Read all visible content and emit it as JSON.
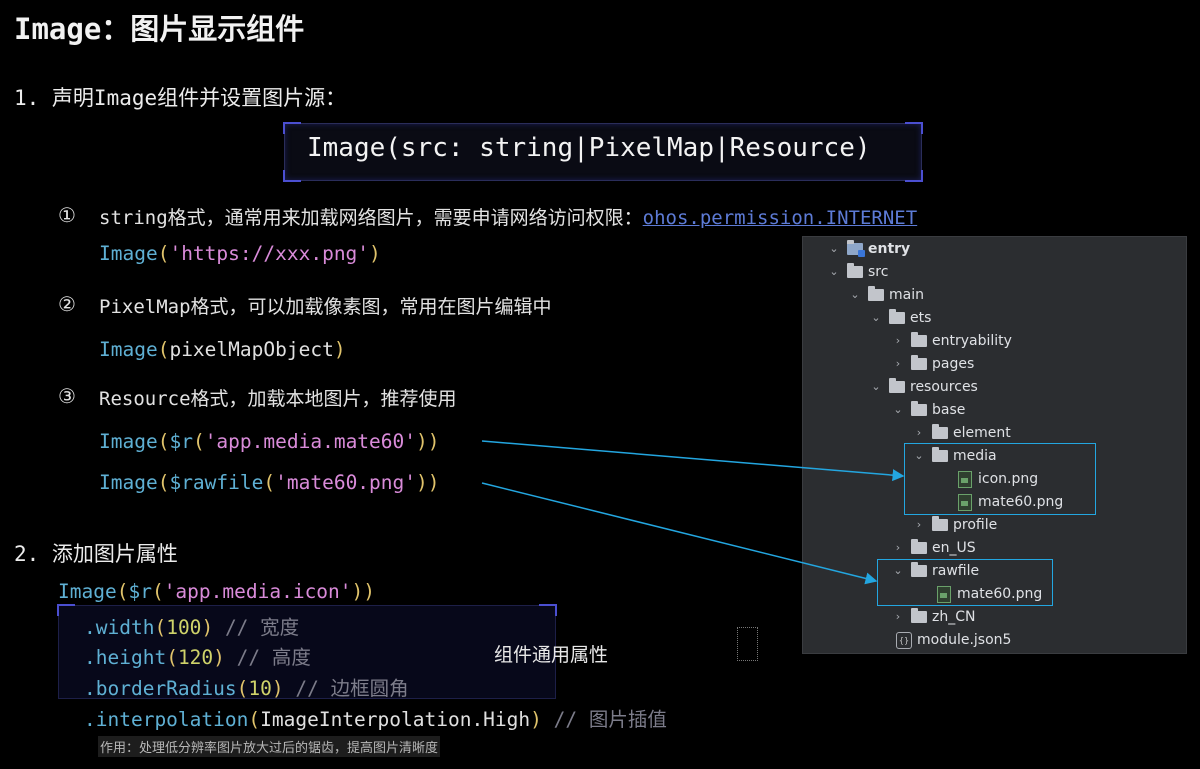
{
  "title": "Image：图片显示组件",
  "step1": {
    "heading": "1. 声明Image组件并设置图片源：",
    "signature": "Image(src: string|PixelMap|Resource)",
    "items": [
      {
        "marker": "①",
        "desc_prefix": "string格式，通常用来加载网络图片，需要申请网络访问权限：",
        "desc_link": "ohos.permission.INTERNET",
        "code": [
          {
            "fn": "Image",
            "open": "(",
            "arg": "'https://xxx.png'",
            "close": ")"
          }
        ]
      },
      {
        "marker": "②",
        "desc_prefix": "PixelMap格式，可以加载像素图，常用在图片编辑中",
        "code": [
          {
            "fn": "Image",
            "open": "(",
            "arg": "pixelMapObject",
            "close": ")"
          }
        ]
      },
      {
        "marker": "③",
        "desc_prefix": "Resource格式，加载本地图片，推荐使用",
        "code": [
          {
            "fn": "Image",
            "open": "(",
            "fn2": "$r",
            "open2": "(",
            "arg": "'app.media.mate60'",
            "close": "))"
          },
          {
            "fn": "Image",
            "open": "(",
            "fn2": "$rawfile",
            "open2": "(",
            "arg": "'mate60.png'",
            "close": "))"
          }
        ]
      }
    ]
  },
  "step2": {
    "heading": "2. 添加图片属性",
    "first_line": {
      "fn": "Image",
      "open": "(",
      "fn2": "$r",
      "open2": "(",
      "arg": "'app.media.icon'",
      "close": "))"
    },
    "props": [
      {
        "name": ".width",
        "open": "(",
        "value": "100",
        "close": ")",
        "comment": "// 宽度"
      },
      {
        "name": ".height",
        "open": "(",
        "value": "120",
        "close": ")",
        "comment": "// 高度"
      },
      {
        "name": ".borderRadius",
        "open": "(",
        "value": "10",
        "close": ")",
        "comment": "// 边框圆角"
      },
      {
        "name": ".interpolation",
        "open": "(",
        "value": "ImageInterpolation.High",
        "close": ")",
        "comment": "// 图片插值"
      }
    ],
    "common_label": "组件通用属性",
    "note": "作用：处理低分辨率图片放大过后的锯齿，提高图片清晰度"
  },
  "tree": {
    "items": [
      {
        "label": "entry",
        "chev": "⌄",
        "type": "module"
      },
      {
        "label": "src",
        "chev": "⌄",
        "type": "folder"
      },
      {
        "label": "main",
        "chev": "⌄",
        "type": "folder"
      },
      {
        "label": "ets",
        "chev": "⌄",
        "type": "folder"
      },
      {
        "label": "entryability",
        "chev": "›",
        "type": "folder"
      },
      {
        "label": "pages",
        "chev": "›",
        "type": "folder"
      },
      {
        "label": "resources",
        "chev": "⌄",
        "type": "folder"
      },
      {
        "label": "base",
        "chev": "⌄",
        "type": "folder"
      },
      {
        "label": "element",
        "chev": "›",
        "type": "folder"
      },
      {
        "label": "media",
        "chev": "⌄",
        "type": "folder"
      },
      {
        "label": "icon.png",
        "chev": "",
        "type": "image"
      },
      {
        "label": "mate60.png",
        "chev": "",
        "type": "image"
      },
      {
        "label": "profile",
        "chev": "›",
        "type": "folder"
      },
      {
        "label": "en_US",
        "chev": "›",
        "type": "folder"
      },
      {
        "label": "rawfile",
        "chev": "⌄",
        "type": "folder"
      },
      {
        "label": "mate60.png",
        "chev": "",
        "type": "image"
      },
      {
        "label": "zh_CN",
        "chev": "›",
        "type": "folder"
      },
      {
        "label": "module.json5",
        "chev": "",
        "type": "json"
      }
    ]
  },
  "colors": {
    "function": "#5fb0d4",
    "paren": "#e0c36b",
    "string": "#d98bd9",
    "number": "#cfd36a",
    "comment": "#7c7c8a",
    "link": "#5d7bd6",
    "highlight": "#23a6e0",
    "tree_bg": "#2b2d30"
  }
}
